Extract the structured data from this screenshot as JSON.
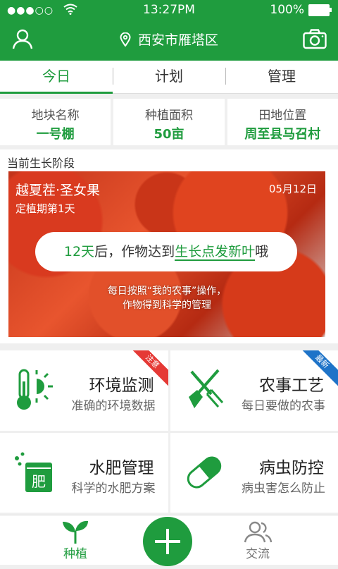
{
  "status": {
    "signal": "●●●○○",
    "time": "13:27PM",
    "battery": "100%"
  },
  "header": {
    "location": "西安市雁塔区"
  },
  "tabs": [
    {
      "label": "今日"
    },
    {
      "label": "计划"
    },
    {
      "label": "管理"
    }
  ],
  "info": [
    {
      "label": "地块名称",
      "value": "一号棚"
    },
    {
      "label": "种植面积",
      "value": "50亩"
    },
    {
      "label": "田地位置",
      "value": "周至县马召村"
    }
  ],
  "stage": {
    "section_title": "当前生长阶段",
    "crop": "越夏茬·圣女果",
    "date": "05月12日",
    "period": "定植期第1天",
    "bubble_days": "12天",
    "bubble_mid": "后，作物达到",
    "bubble_target": "生长点发新叶",
    "bubble_end": "哦",
    "note_line1": "每日按照“我的农事”操作，",
    "note_line2": "作物得到科学的管理"
  },
  "cards": [
    {
      "title": "环境监测",
      "subtitle": "准确的环境数据",
      "ribbon": "注意",
      "ribbon_color": "#e53935"
    },
    {
      "title": "农事工艺",
      "subtitle": "每日要做的农事",
      "ribbon": "最新",
      "ribbon_color": "#1e73c8"
    },
    {
      "title": "水肥管理",
      "subtitle": "科学的水肥方案",
      "icon_text": "肥"
    },
    {
      "title": "病虫防控",
      "subtitle": "病虫害怎么防止"
    }
  ],
  "bottom": {
    "plant_label": "种植",
    "community_label": "交流"
  },
  "colors": {
    "brand": "#1f9c3e"
  }
}
